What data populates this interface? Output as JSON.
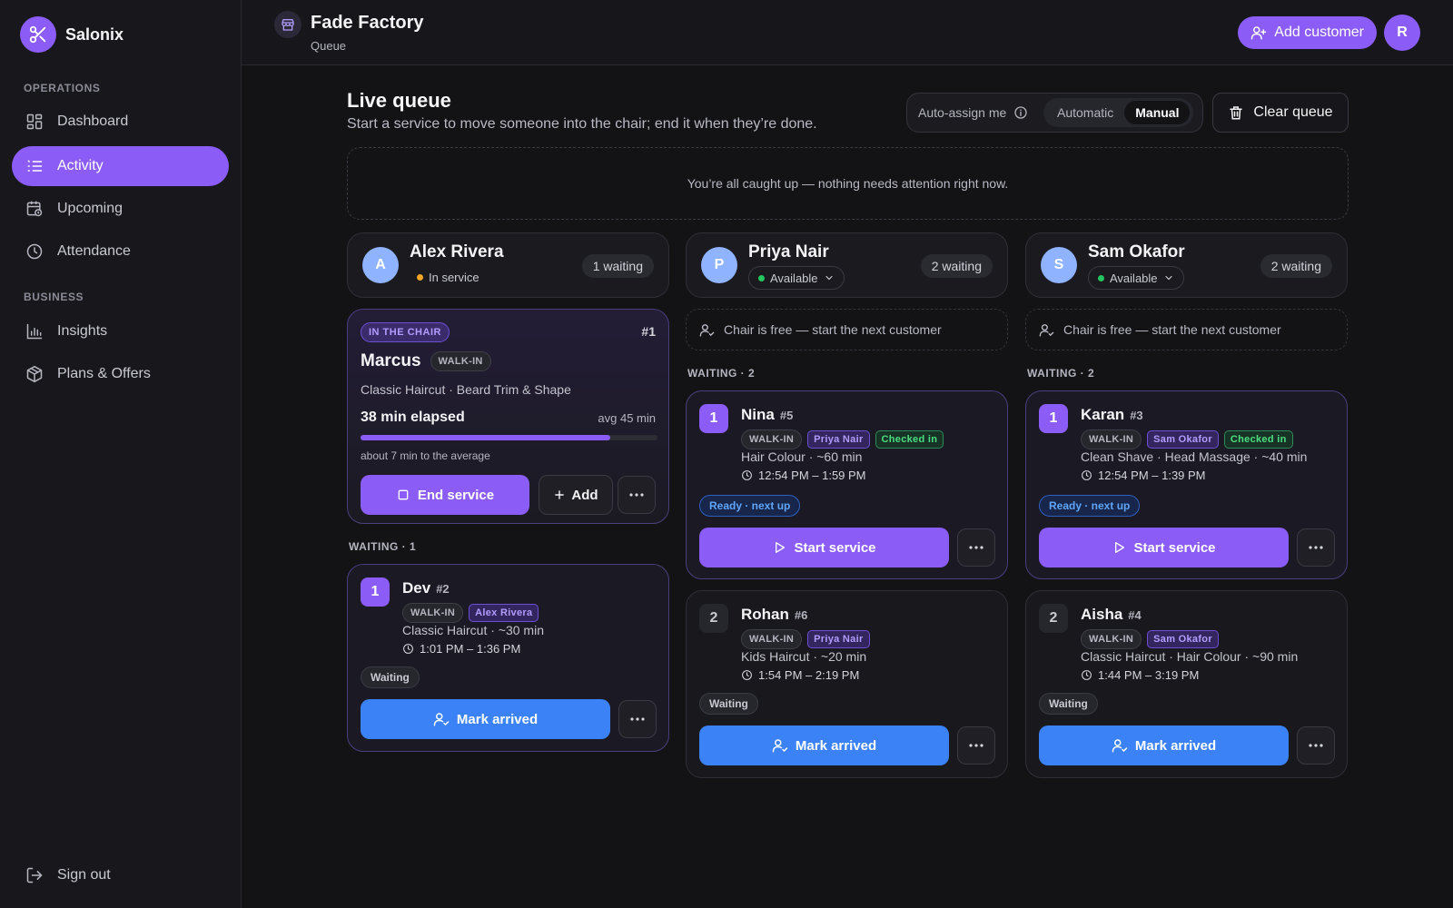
{
  "brand": {
    "name": "Salonix"
  },
  "sidebar": {
    "sections": [
      {
        "title": "OPERATIONS",
        "items": [
          {
            "label": "Dashboard",
            "icon": "grid-icon"
          },
          {
            "label": "Activity",
            "icon": "list-icon",
            "active": true
          },
          {
            "label": "Upcoming",
            "icon": "calendar-clock-icon"
          },
          {
            "label": "Attendance",
            "icon": "clock-icon"
          }
        ]
      },
      {
        "title": "BUSINESS",
        "items": [
          {
            "label": "Insights",
            "icon": "bar-chart-icon"
          },
          {
            "label": "Plans & Offers",
            "icon": "package-icon"
          }
        ]
      }
    ],
    "signout": "Sign out"
  },
  "topbar": {
    "shop_name": "Fade Factory",
    "page": "Queue",
    "add_customer": "Add customer",
    "avatar": "R"
  },
  "header": {
    "title": "Live queue",
    "subtitle": "Start a service to move someone into the chair; end it when they’re done.",
    "auto_assign_label": "Auto-assign me",
    "mode_options": [
      "Automatic",
      "Manual"
    ],
    "mode_selected": "Manual",
    "clear_queue": "Clear queue"
  },
  "notice": "You’re all caught up — nothing needs attention right now.",
  "colors": {
    "accent": "#8b5cf6",
    "blue": "#3b82f6",
    "in_service_dot": "#f5a623",
    "available_dot": "#22c55e"
  },
  "barbers": [
    {
      "initial": "A",
      "name": "Alex Rivera",
      "status": "In service",
      "waiting": "1 waiting",
      "in_chair": {
        "badge": "IN THE CHAIR",
        "ticket": "#1",
        "customer": "Marcus",
        "tag": "WALK-IN",
        "services": "Classic Haircut · Beard Trim & Shape",
        "elapsed": "38 min elapsed",
        "avg": "avg 45 min",
        "progress": 0.84,
        "note": "about 7 min to the average",
        "end_label": "End service",
        "add_label": "Add"
      },
      "waiting_label": "WAITING · 1",
      "queue": [
        {
          "pos": "1",
          "name": "Dev",
          "ticket": "#2",
          "tags": [
            "WALK-IN",
            "Alex Rivera"
          ],
          "checked": "",
          "services": "Classic Haircut · ~30 min",
          "time": "1:01 PM – 1:36 PM",
          "status": "Waiting",
          "action": "Mark arrived"
        }
      ]
    },
    {
      "initial": "P",
      "name": "Priya Nair",
      "status": "Available",
      "waiting": "2 waiting",
      "chair_free": "Chair is free — start the next customer",
      "waiting_label": "WAITING · 2",
      "queue": [
        {
          "pos": "1",
          "name": "Nina",
          "ticket": "#5",
          "tags": [
            "WALK-IN",
            "Priya Nair"
          ],
          "checked": "Checked in",
          "services": "Hair Colour · ~60 min",
          "time": "12:54 PM – 1:59 PM",
          "status": "Ready · next up",
          "action": "Start service"
        },
        {
          "pos": "2",
          "name": "Rohan",
          "ticket": "#6",
          "tags": [
            "WALK-IN",
            "Priya Nair"
          ],
          "checked": "",
          "services": "Kids Haircut · ~20 min",
          "time": "1:54 PM – 2:19 PM",
          "status": "Waiting",
          "action": "Mark arrived"
        }
      ]
    },
    {
      "initial": "S",
      "name": "Sam Okafor",
      "status": "Available",
      "waiting": "2 waiting",
      "chair_free": "Chair is free — start the next customer",
      "waiting_label": "WAITING · 2",
      "queue": [
        {
          "pos": "1",
          "name": "Karan",
          "ticket": "#3",
          "tags": [
            "WALK-IN",
            "Sam Okafor"
          ],
          "checked": "Checked in",
          "services": "Clean Shave · Head Massage · ~40 min",
          "time": "12:54 PM – 1:39 PM",
          "status": "Ready · next up",
          "action": "Start service"
        },
        {
          "pos": "2",
          "name": "Aisha",
          "ticket": "#4",
          "tags": [
            "WALK-IN",
            "Sam Okafor"
          ],
          "checked": "",
          "services": "Classic Haircut · Hair Colour · ~90 min",
          "time": "1:44 PM – 3:19 PM",
          "status": "Waiting",
          "action": "Mark arrived"
        }
      ]
    }
  ]
}
